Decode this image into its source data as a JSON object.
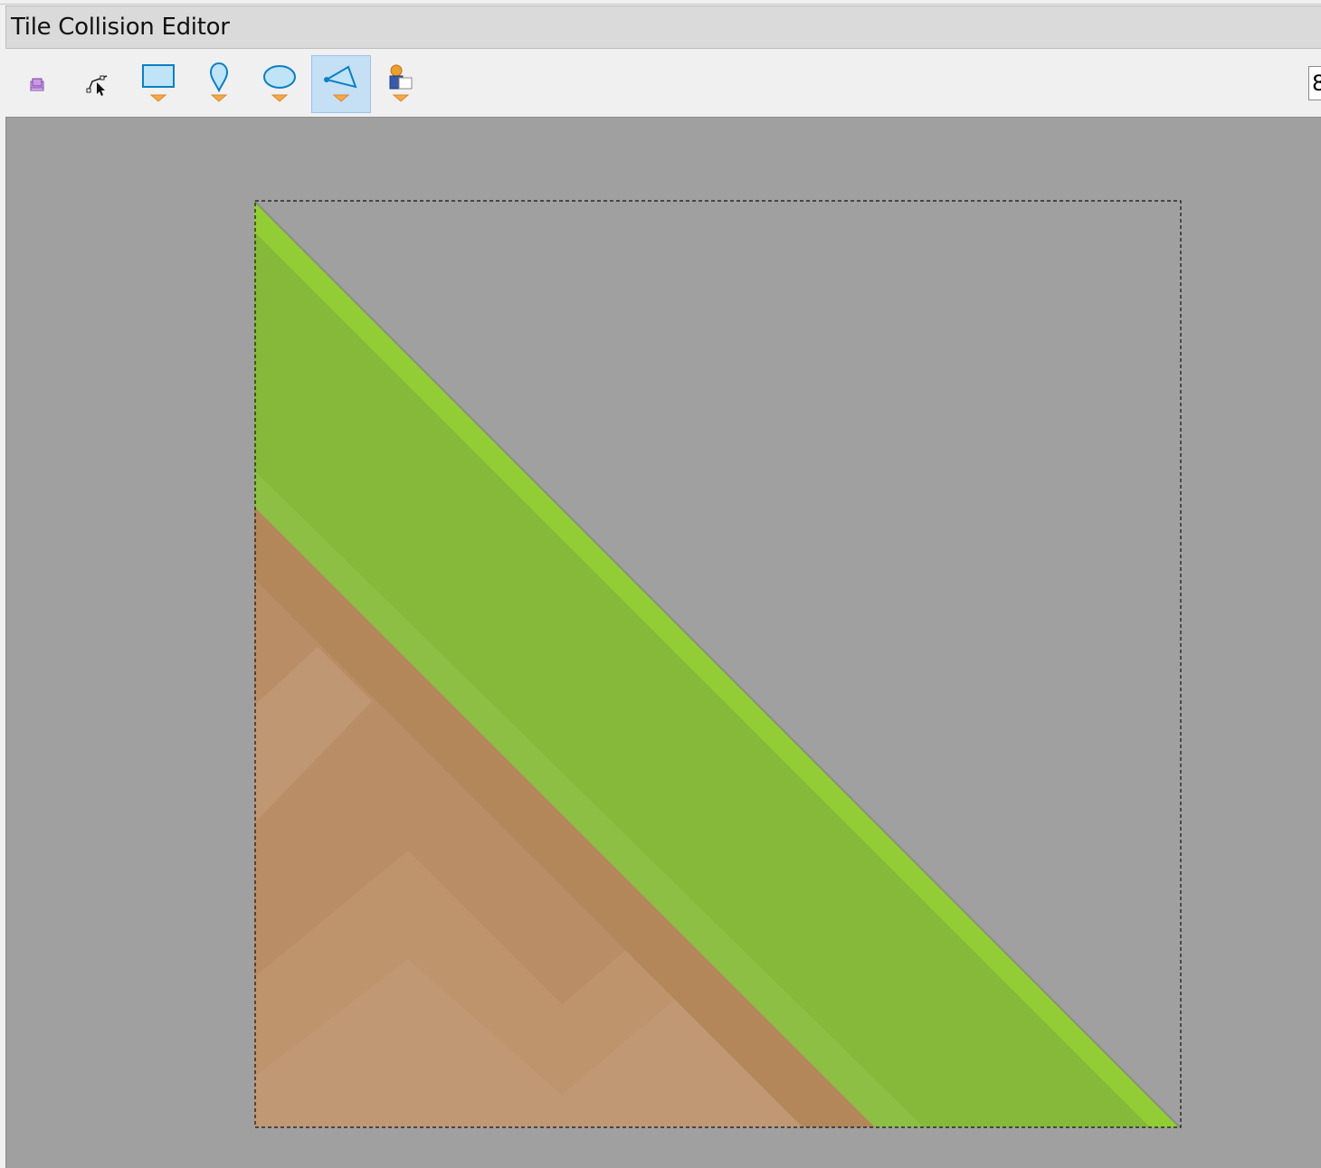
{
  "window": {
    "title": "Tile Collision Editor"
  },
  "toolbar": {
    "tools": [
      {
        "name": "select-objects",
        "icon": "select-objects-icon"
      },
      {
        "name": "edit-polygons",
        "icon": "edit-polygons-icon"
      },
      {
        "name": "rectangle",
        "icon": "rectangle-icon"
      },
      {
        "name": "point",
        "icon": "point-icon"
      },
      {
        "name": "ellipse",
        "icon": "ellipse-icon"
      },
      {
        "name": "polygon",
        "icon": "polygon-icon",
        "active": true
      },
      {
        "name": "template",
        "icon": "template-icon"
      }
    ],
    "zoom_value": "8"
  },
  "colors": {
    "canvas_background": "#a0a0a0",
    "grass": "#86b83a",
    "grass_highlight": "#93cd36",
    "dirt": "#b5895e",
    "dirt_light": "#c09874",
    "active_tool": "#c5dff5"
  }
}
